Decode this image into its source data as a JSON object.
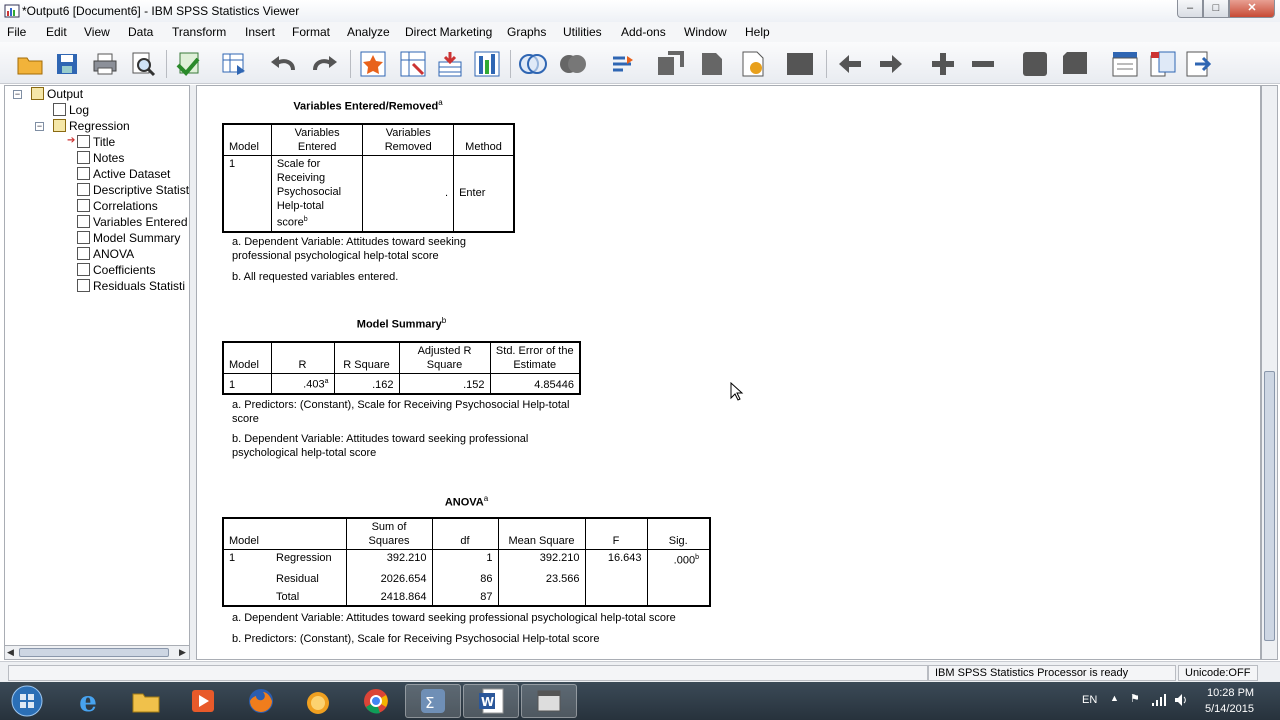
{
  "window": {
    "title": "*Output6 [Document6] - IBM SPSS Statistics Viewer",
    "min": "–",
    "max": "□",
    "close": "✕"
  },
  "menu": [
    "File",
    "Edit",
    "View",
    "Data",
    "Transform",
    "Insert",
    "Format",
    "Analyze",
    "Direct Marketing",
    "Graphs",
    "Utilities",
    "Add-ons",
    "Window",
    "Help"
  ],
  "tree": {
    "output": "Output",
    "log": "Log",
    "regression": "Regression",
    "items": [
      "Title",
      "Notes",
      "Active Dataset",
      "Descriptive Statist",
      "Correlations",
      "Variables Entered",
      "Model Summary",
      "ANOVA",
      "Coefficients",
      "Residuals Statisti"
    ]
  },
  "var_entered": {
    "title": "Variables Entered/Removed",
    "title_sup": "a",
    "headers": [
      "Model",
      "Variables Entered",
      "Variables Removed",
      "Method"
    ],
    "row": {
      "model": "1",
      "entered": "Scale for Receiving Psychosocial Help-total score",
      "entered_sup": "b",
      "removed": ".",
      "method": "Enter"
    },
    "notes": [
      "a. Dependent Variable: Attitudes toward seeking professional psychological help-total score",
      "b. All requested variables entered."
    ]
  },
  "model_summary": {
    "title": "Model Summary",
    "title_sup": "b",
    "headers": [
      "Model",
      "R",
      "R Square",
      "Adjusted R Square",
      "Std. Error of the Estimate"
    ],
    "row": {
      "model": "1",
      "r": ".403",
      "r_sup": "a",
      "r2": ".162",
      "adj": ".152",
      "se": "4.85446"
    },
    "notes": [
      "a. Predictors: (Constant), Scale for Receiving Psychosocial Help-total score",
      "b. Dependent Variable: Attitudes toward seeking professional psychological help-total score"
    ]
  },
  "anova": {
    "title": "ANOVA",
    "title_sup": "a",
    "headers": [
      "Model",
      "Sum of Squares",
      "df",
      "Mean Square",
      "F",
      "Sig."
    ],
    "model": "1",
    "rows": [
      {
        "label": "Regression",
        "ss": "392.210",
        "df": "1",
        "ms": "392.210",
        "f": "16.643",
        "sig": ".000",
        "sig_sup": "b"
      },
      {
        "label": "Residual",
        "ss": "2026.654",
        "df": "86",
        "ms": "23.566"
      },
      {
        "label": "Total",
        "ss": "2418.864",
        "df": "87"
      }
    ],
    "notes": [
      "a. Dependent Variable: Attitudes toward seeking professional psychological help-total score",
      "b. Predictors: (Constant), Scale for Receiving Psychosocial Help-total score"
    ]
  },
  "status": {
    "processor": "IBM SPSS Statistics Processor is ready",
    "unicode": "Unicode:OFF"
  },
  "tray": {
    "lang": "EN",
    "time": "10:28 PM",
    "date": "5/14/2015"
  },
  "colors": {
    "titlebar": "#eef1f6",
    "taskbar": "#2f3b46",
    "close": "#c74a35",
    "accent": "#1f5fb4"
  }
}
